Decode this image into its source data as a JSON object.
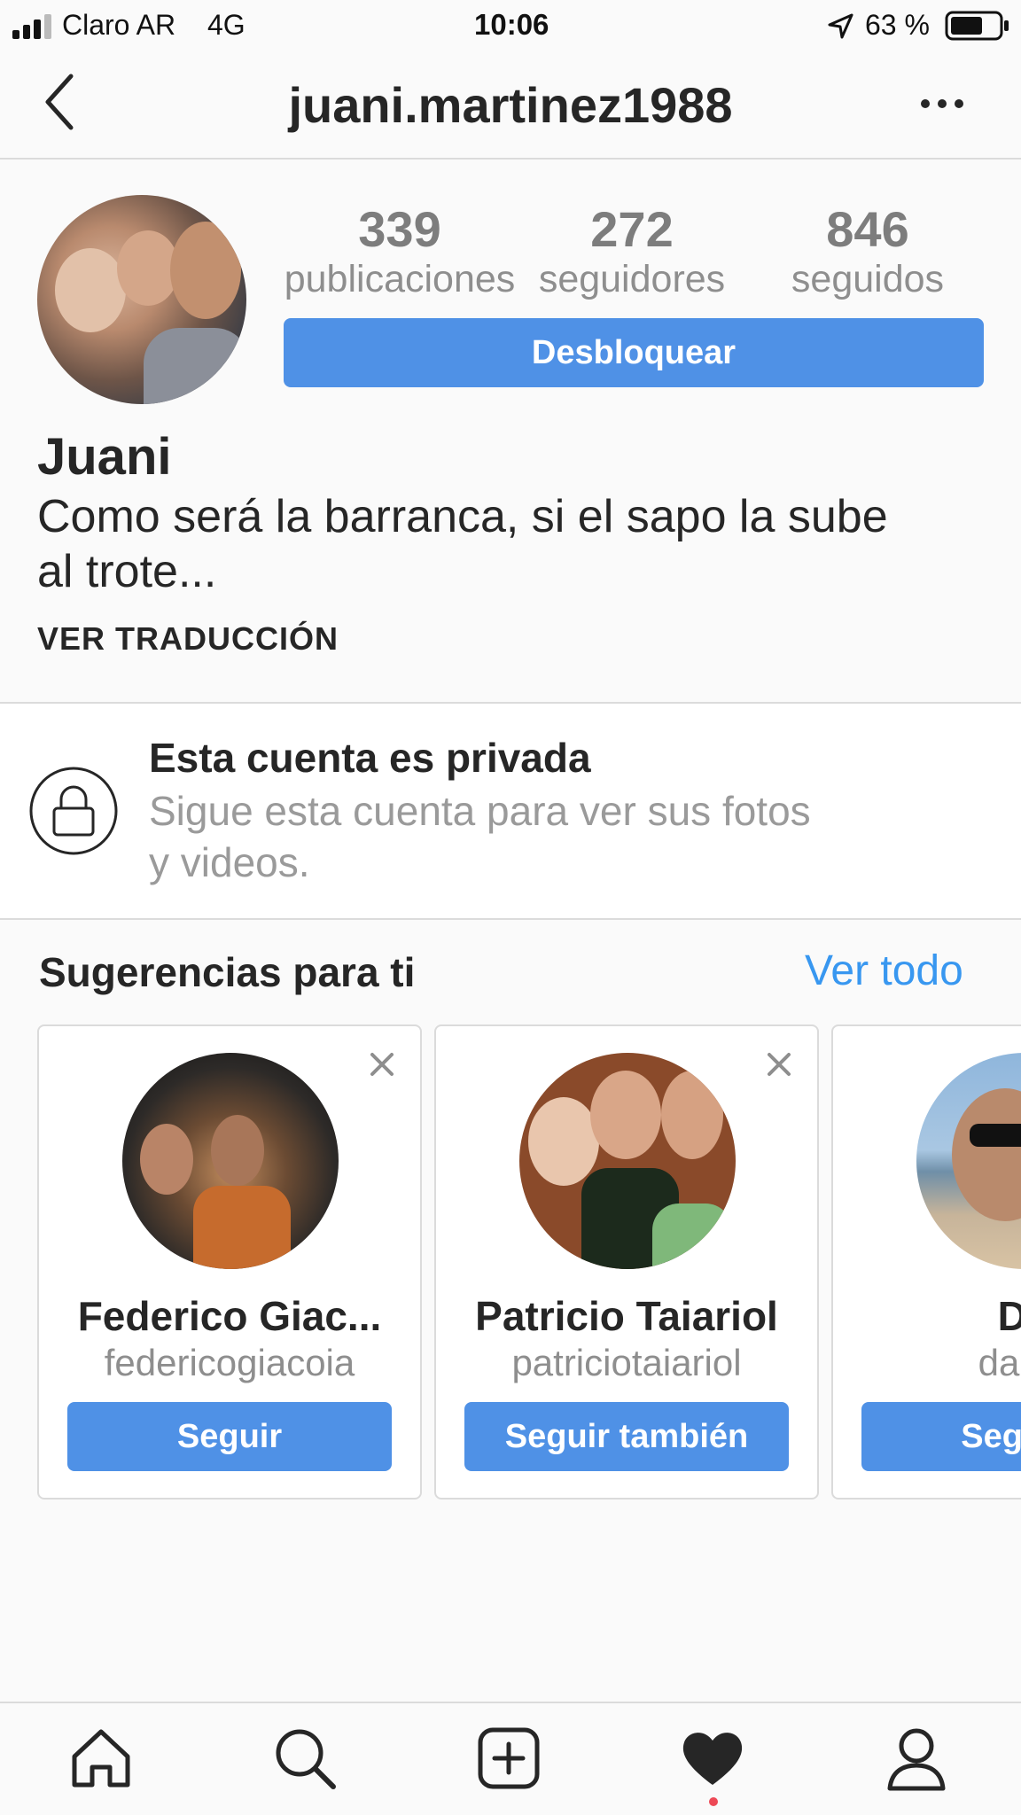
{
  "status_bar": {
    "carrier": "Claro AR",
    "network": "4G",
    "time": "10:06",
    "battery": "63 %"
  },
  "header": {
    "back_icon": "chevron-left-icon",
    "username": "juani.martinez1988",
    "more_icon": "more-horizontal-icon"
  },
  "profile": {
    "stats": [
      {
        "value": "339",
        "label": "publicaciones"
      },
      {
        "value": "272",
        "label": "seguidores"
      },
      {
        "value": "846",
        "label": "seguidos"
      }
    ],
    "action_label": "Desbloquear",
    "name": "Juani",
    "bio_line1": "Como será la barranca, si el sapo la sube",
    "bio_line2": "al trote...",
    "translate_label": "VER TRADUCCIÓN"
  },
  "private_notice": {
    "icon": "lock-icon",
    "title": "Esta cuenta es privada",
    "line1": "Sigue esta cuenta para ver sus fotos",
    "line2": "y videos."
  },
  "suggestions": {
    "title": "Sugerencias para ti",
    "see_all": "Ver todo",
    "cards": [
      {
        "name": "Federico Giac...",
        "username": "federicogiacoia",
        "button": "Seguir"
      },
      {
        "name": "Patricio Taiariol",
        "username": "patriciotaiariol",
        "button": "Seguir también"
      },
      {
        "name": "Da",
        "username": "da.ric",
        "button": "Seguir t"
      }
    ]
  },
  "tab_bar": {
    "items": [
      "home-icon",
      "search-icon",
      "add-post-icon",
      "activity-heart-icon",
      "profile-icon"
    ]
  },
  "colors": {
    "accent": "#4f91e6",
    "link": "#3897f0",
    "notification_dot": "#ed4956"
  }
}
